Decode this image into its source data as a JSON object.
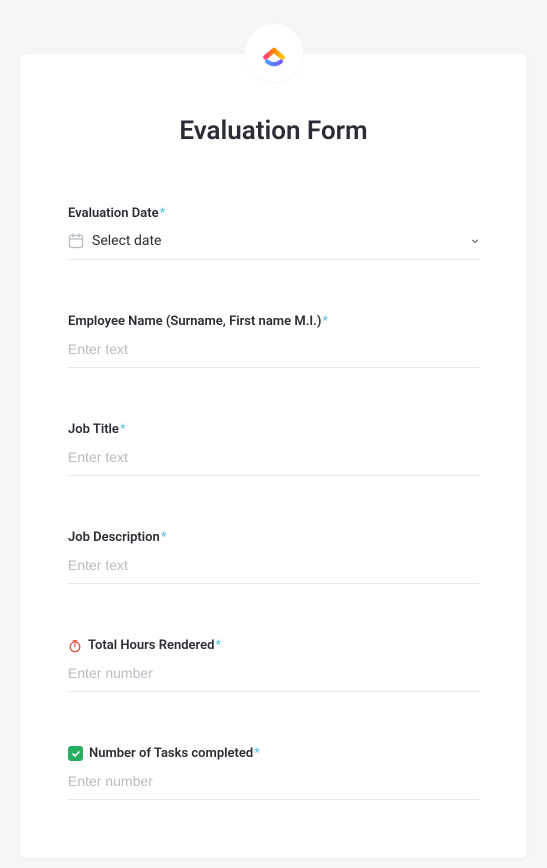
{
  "title": "Evaluation Form",
  "fields": {
    "eval_date": {
      "label": "Evaluation Date",
      "placeholder": "Select date"
    },
    "employee_name": {
      "label": "Employee Name (Surname, First name M.I.)",
      "placeholder": "Enter text"
    },
    "job_title": {
      "label": "Job Title",
      "placeholder": "Enter text"
    },
    "job_description": {
      "label": "Job Description",
      "placeholder": "Enter text"
    },
    "total_hours": {
      "label": "Total Hours Rendered",
      "placeholder": "Enter number"
    },
    "tasks_completed": {
      "label": "Number of Tasks completed",
      "placeholder": "Enter number"
    }
  },
  "required_mark": "*"
}
